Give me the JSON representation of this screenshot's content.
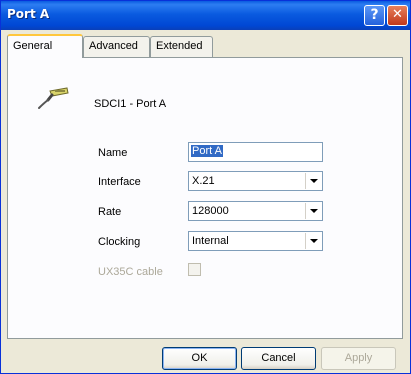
{
  "window": {
    "title": "Port A"
  },
  "titlebar": {
    "help_glyph": "?",
    "close_glyph": "✕"
  },
  "tabs": [
    {
      "label": "General",
      "active": true
    },
    {
      "label": "Advanced",
      "active": false
    },
    {
      "label": "Extended",
      "active": false
    }
  ],
  "header": {
    "icon": "serial-port-connector-icon",
    "title": "SDCI1 - Port A"
  },
  "form": {
    "name": {
      "label": "Name",
      "value": "Port A"
    },
    "interface": {
      "label": "Interface",
      "value": "X.21"
    },
    "rate": {
      "label": "Rate",
      "value": "128000"
    },
    "clocking": {
      "label": "Clocking",
      "value": "Internal"
    },
    "ux35c": {
      "label": "UX35C cable",
      "checked": false,
      "enabled": false
    }
  },
  "buttons": {
    "ok": "OK",
    "cancel": "Cancel",
    "apply": "Apply"
  }
}
